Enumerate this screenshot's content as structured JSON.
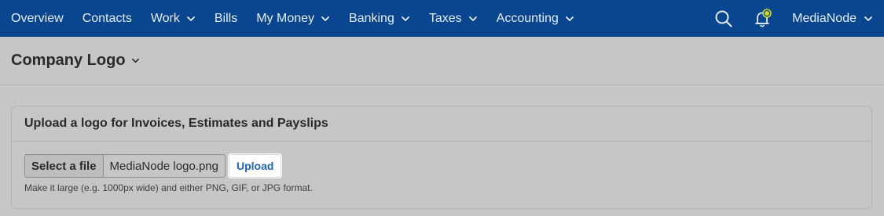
{
  "nav": {
    "items": [
      {
        "label": "Overview",
        "dropdown": false
      },
      {
        "label": "Contacts",
        "dropdown": false
      },
      {
        "label": "Work",
        "dropdown": true
      },
      {
        "label": "Bills",
        "dropdown": false
      },
      {
        "label": "My Money",
        "dropdown": true
      },
      {
        "label": "Banking",
        "dropdown": true
      },
      {
        "label": "Taxes",
        "dropdown": true
      },
      {
        "label": "Accounting",
        "dropdown": true
      }
    ],
    "search_icon": "search-icon",
    "notification_icon": "bell-icon",
    "account_name": "MediaNode",
    "bar_color": "#0a4690",
    "notification_dot_color": "#c9d629"
  },
  "page": {
    "title": "Company Logo"
  },
  "logo_panel": {
    "heading": "Upload a logo for Invoices, Estimates and Payslips",
    "select_label": "Select a file",
    "file_name": "MediaNode logo.png",
    "upload_label": "Upload",
    "hint": "Make it large (e.g. 1000px wide) and either PNG, GIF, or JPG format."
  }
}
